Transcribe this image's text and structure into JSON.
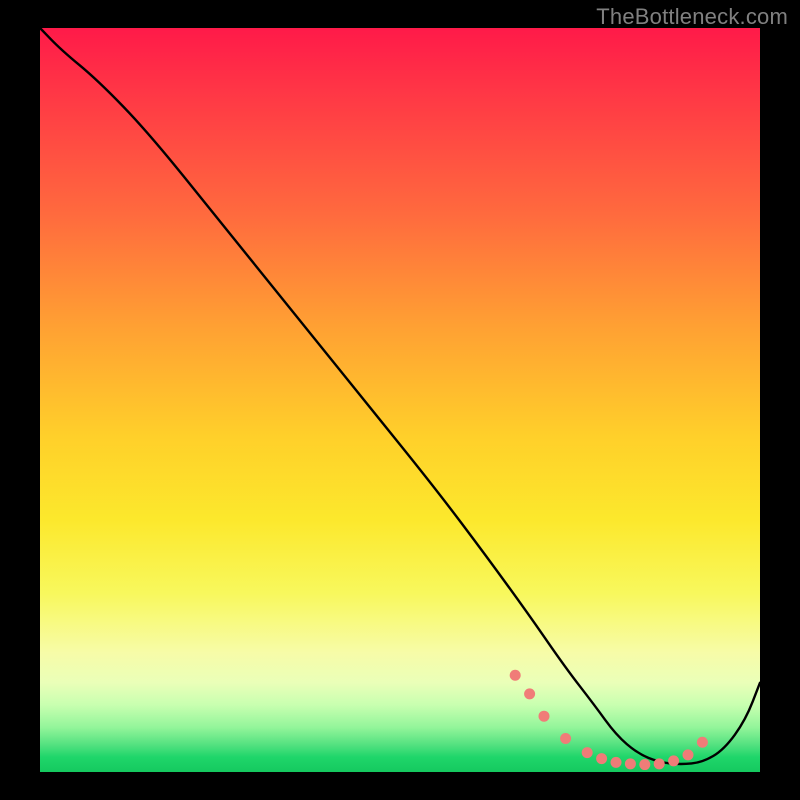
{
  "watermark": "TheBottleneck.com",
  "chart_data": {
    "type": "line",
    "title": "",
    "xlabel": "",
    "ylabel": "",
    "xlim": [
      0,
      100
    ],
    "ylim": [
      0,
      100
    ],
    "series": [
      {
        "name": "curve",
        "x": [
          0,
          3,
          8,
          15,
          25,
          35,
          45,
          55,
          62,
          68,
          73,
          77,
          80,
          83,
          86,
          89,
          92,
          95,
          98,
          100
        ],
        "y": [
          100,
          97,
          93,
          86,
          74,
          62,
          50,
          38,
          29,
          21,
          14,
          9,
          5,
          2.5,
          1.3,
          1.0,
          1.3,
          3,
          7,
          12
        ]
      }
    ],
    "markers": {
      "name": "valley-dots",
      "color": "#f07c78",
      "x": [
        66,
        68,
        70,
        73,
        76,
        78,
        80,
        82,
        84,
        86,
        88,
        90,
        92
      ],
      "y": [
        13,
        10.5,
        7.5,
        4.5,
        2.6,
        1.8,
        1.3,
        1.1,
        1.0,
        1.1,
        1.5,
        2.3,
        4.0
      ]
    },
    "gradient_stops": [
      {
        "pos": 0.0,
        "color": "#ff1a49"
      },
      {
        "pos": 0.25,
        "color": "#ff6a3e"
      },
      {
        "pos": 0.55,
        "color": "#ffd02a"
      },
      {
        "pos": 0.76,
        "color": "#f8f85d"
      },
      {
        "pos": 0.9,
        "color": "#d6ffb0"
      },
      {
        "pos": 1.0,
        "color": "#15c95f"
      }
    ]
  }
}
